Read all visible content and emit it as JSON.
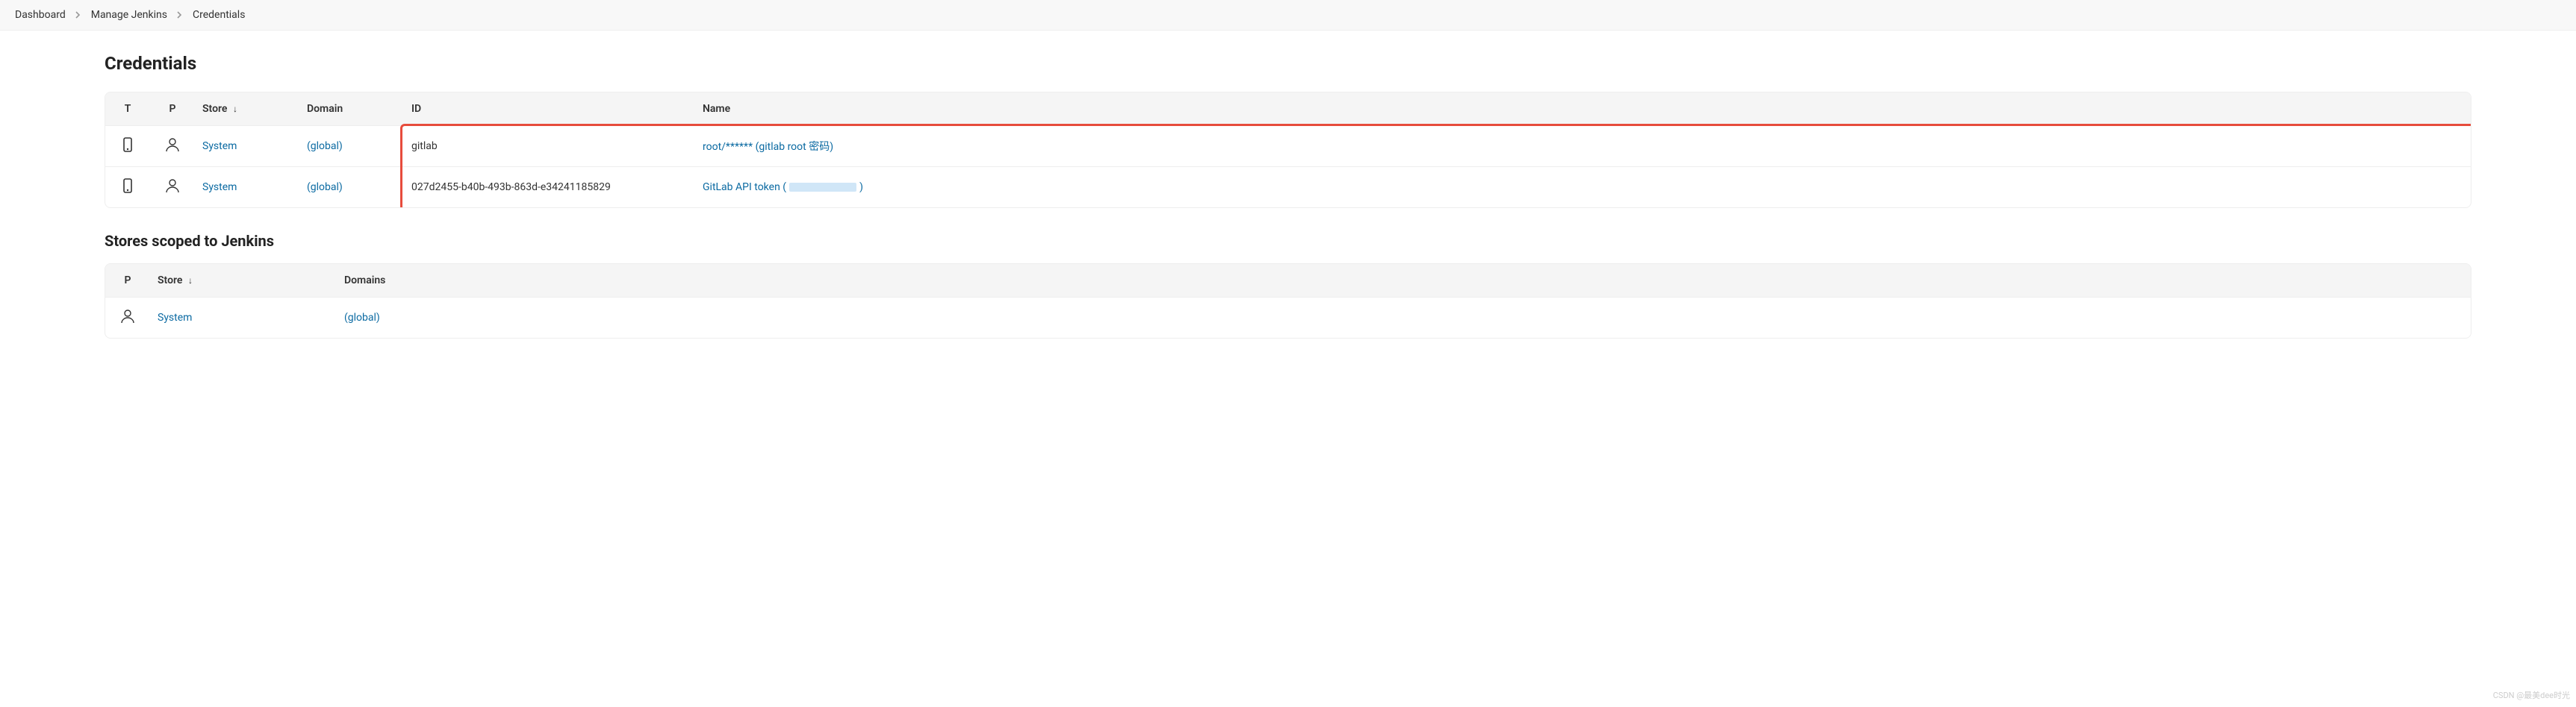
{
  "breadcrumb": {
    "items": [
      "Dashboard",
      "Manage Jenkins",
      "Credentials"
    ]
  },
  "page_title": "Credentials",
  "credentials_table": {
    "headers": {
      "t": "T",
      "p": "P",
      "store": "Store",
      "domain": "Domain",
      "id": "ID",
      "name": "Name"
    },
    "rows": [
      {
        "store": "System",
        "domain": "(global)",
        "id": "gitlab",
        "name": "root/****** (gitlab root 密码)"
      },
      {
        "store": "System",
        "domain": "(global)",
        "id": "027d2455-b40b-493b-863d-e34241185829",
        "name_prefix": "GitLab API token (",
        "name_suffix": ")"
      }
    ]
  },
  "stores_section": {
    "title": "Stores scoped to Jenkins",
    "headers": {
      "p": "P",
      "store": "Store",
      "domains": "Domains"
    },
    "rows": [
      {
        "store": "System",
        "domains": "(global)"
      }
    ]
  },
  "watermark": "CSDN @最美dee时光"
}
